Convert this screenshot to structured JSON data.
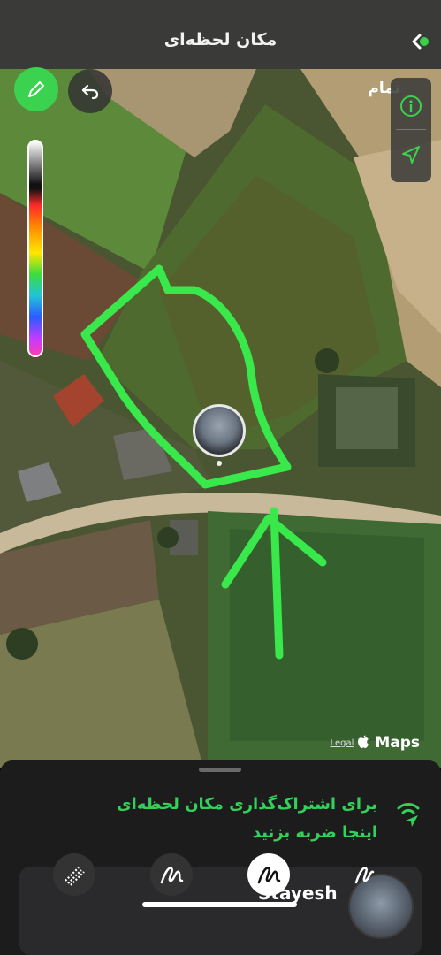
{
  "header": {
    "title": "مکان لحظه‌ای",
    "back_icon": "chevron-back-icon"
  },
  "map": {
    "done_label": "تمام",
    "attribution_legal": "Legal",
    "attribution_maps": "Maps",
    "drawing_color": "#39e84a"
  },
  "controls": {
    "pen_icon": "pencil-icon",
    "undo_icon": "undo-icon",
    "info_icon": "info-icon",
    "location_icon": "location-arrow-icon"
  },
  "sheet": {
    "message": "برای اشتراک‌گذاری مکان لحظه‌ای اینجا ضربه بزنید",
    "accent": "#33d05a"
  },
  "peek": {
    "name": "Stayesh"
  },
  "tools": [
    "marker-tool-icon",
    "pen-tool-icon",
    "pen-tool-selected-icon",
    "brush-tool-icon"
  ]
}
